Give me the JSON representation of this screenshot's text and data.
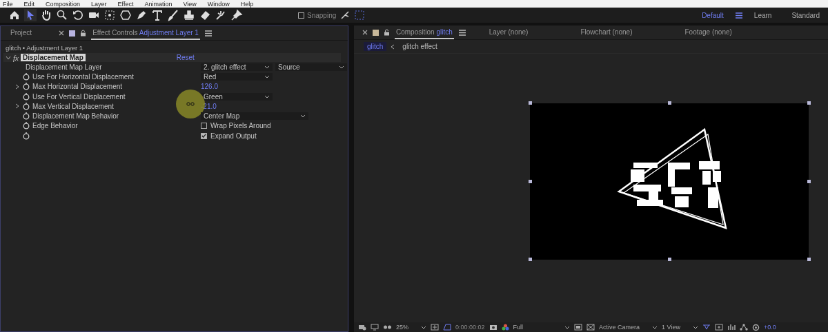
{
  "menu_bar": [
    "File",
    "Edit",
    "Composition",
    "Layer",
    "Effect",
    "Animation",
    "View",
    "Window",
    "Help"
  ],
  "toolbar": {
    "snapping": {
      "label": "Snapping",
      "checked": false
    }
  },
  "workspaces": [
    {
      "label": "Default",
      "selected": true
    },
    {
      "label": "Learn",
      "selected": false
    },
    {
      "label": "Standard",
      "selected": false
    }
  ],
  "effect_controls": {
    "tabs": [
      {
        "label": "Project",
        "selected": false
      },
      {
        "label": "Effect Controls",
        "layer": "Adjustment Layer 1",
        "selected": true
      }
    ],
    "subtitle": "glitch • Adjustment Layer 1",
    "effect": {
      "badge": "fx",
      "name": "Displacement Map",
      "expanded": true,
      "reset": "Reset"
    },
    "properties": [
      {
        "name": "Displacement Map Layer",
        "stopwatch": false,
        "kind": "dropdown",
        "values": [
          "2. glitch effect",
          "Source"
        ]
      },
      {
        "name": "Use For Horizontal Displacement",
        "stopwatch": true,
        "kind": "dropdown",
        "values": [
          "Red"
        ]
      },
      {
        "name": "Max Horizontal Displacement",
        "stopwatch": true,
        "expanded": false,
        "kind": "number",
        "value": "126.0"
      },
      {
        "name": "Use For Vertical Displacement",
        "stopwatch": true,
        "kind": "dropdown",
        "values": [
          "Green"
        ]
      },
      {
        "name": "Max Vertical Displacement",
        "stopwatch": true,
        "expanded": false,
        "kind": "number",
        "value": "-21.0",
        "cursor": true
      },
      {
        "name": "Displacement Map Behavior",
        "stopwatch": true,
        "kind": "dropdown",
        "wide": true,
        "values": [
          "Center Map"
        ]
      },
      {
        "name": "Edge Behavior",
        "stopwatch": true,
        "kind": "checkbox",
        "label": "Wrap Pixels Around",
        "checked": false
      },
      {
        "stopwatch": true,
        "kind": "checkbox",
        "label": "Expand Output",
        "checked": true
      }
    ]
  },
  "composition": {
    "tabs": [
      {
        "label": "Composition",
        "name": "glitch",
        "selected": true
      },
      {
        "label": "Layer (none)",
        "selected": false
      },
      {
        "label": "Flowchart (none)",
        "selected": false
      },
      {
        "label": "Footage (none)",
        "selected": false
      }
    ],
    "breadcrumbs": [
      {
        "label": "glitch",
        "selected": true
      },
      {
        "label": "glitch effect",
        "selected": false
      }
    ],
    "viewer_bar": {
      "zoom": "25%",
      "timecode": "0:00:00:02",
      "resolution": "Full",
      "camera": "Active Camera",
      "views": "1 View",
      "exposure": "+0.0"
    }
  }
}
